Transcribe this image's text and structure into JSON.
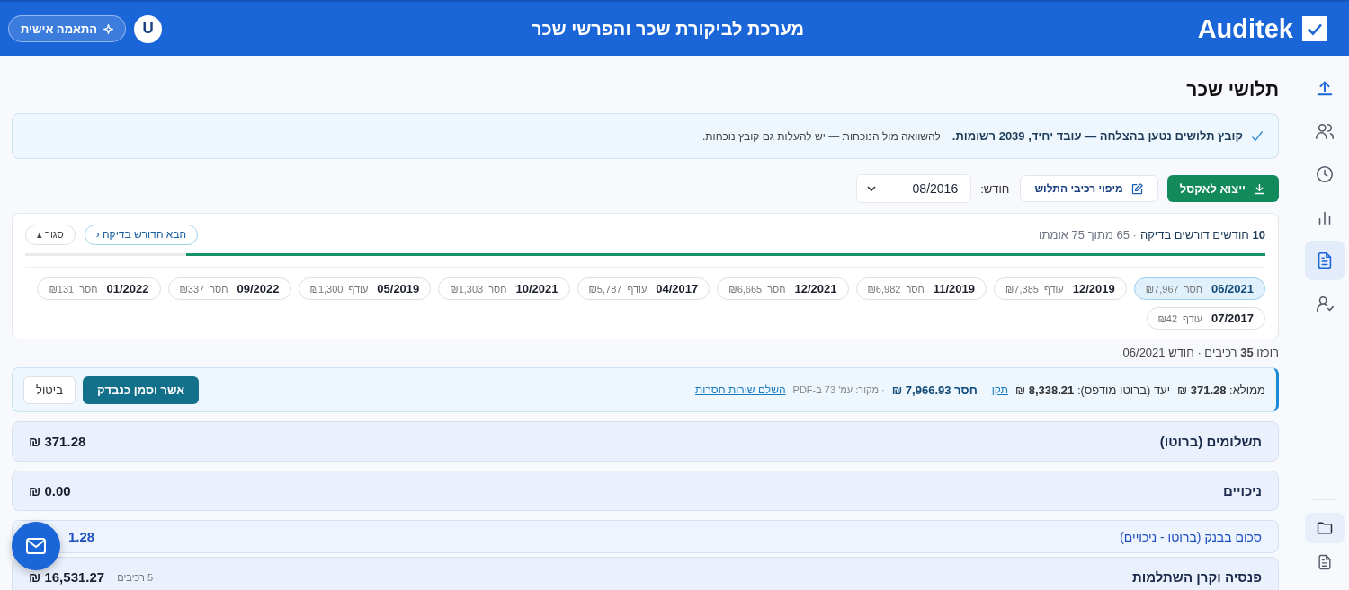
{
  "header": {
    "logo_text": "Auditek",
    "title": "מערכת לביקורת שכר והפרשי שכר",
    "customize_button": "התאמה אישית",
    "avatar": "U"
  },
  "sidebar": {
    "items": [
      {
        "kind": "upload",
        "selected": false,
        "active": true
      },
      {
        "kind": "users",
        "selected": false,
        "active": false
      },
      {
        "kind": "clock",
        "selected": false,
        "active": false
      },
      {
        "kind": "chart",
        "selected": false,
        "active": false
      },
      {
        "kind": "document",
        "selected": true,
        "active": false
      },
      {
        "kind": "user-check",
        "selected": false,
        "active": false
      }
    ],
    "bottom_items": [
      {
        "kind": "folder",
        "selected": true
      },
      {
        "kind": "document",
        "selected": false
      }
    ]
  },
  "page_title": "תלושי שכר",
  "alert": {
    "strong": "קובץ תלושים נטען בהצלחה — עובד יחיד, 2039 רשומות.",
    "note": "להשוואה מול הנוכחות — יש להעלות גם קובץ נוכחות."
  },
  "toolbar": {
    "export_button": "ייצוא לאקסל",
    "mapping_button": "מיפוי רכיבי התלוש",
    "month_label": "חודש:",
    "month_value": "08/2016"
  },
  "review": {
    "count_text": "**10** חודשים דורשים בדיקה",
    "progress_text": "· 65 מתוך 75 אומתו",
    "next_button": "הבא הדורש בדיקה ‹",
    "close_button": "סגור ▴",
    "level": 0.87,
    "months": [
      {
        "month": "06/2021",
        "status": "חסר",
        "amount": "₪7,967",
        "selected": true
      },
      {
        "month": "12/2019",
        "status": "עודף",
        "amount": "₪7,385",
        "selected": false
      },
      {
        "month": "11/2019",
        "status": "חסר",
        "amount": "₪6,982",
        "selected": false
      },
      {
        "month": "12/2021",
        "status": "חסר",
        "amount": "₪6,665",
        "selected": false
      },
      {
        "month": "04/2017",
        "status": "עודף",
        "amount": "₪5,787",
        "selected": false
      },
      {
        "month": "10/2021",
        "status": "חסר",
        "amount": "₪1,303",
        "selected": false
      },
      {
        "month": "05/2019",
        "status": "עודף",
        "amount": "₪1,300",
        "selected": false
      },
      {
        "month": "09/2022",
        "status": "חסר",
        "amount": "₪337",
        "selected": false
      },
      {
        "month": "01/2022",
        "status": "חסר",
        "amount": "₪131",
        "selected": false
      },
      {
        "month": "07/2017",
        "status": "עודף",
        "amount": "₪42",
        "selected": false
      }
    ]
  },
  "collected": "רוכזו **35** רכיבים · חודש 06/2021",
  "edit_bar": {
    "filled": "ממולא: **371.28** ₪",
    "target": "יעד (ברוטו מודפס): **8,338.21** ₪",
    "fix_link": "תקן",
    "missing": "חסר 7,966.93 ₪",
    "source": "· מקור: עמ' 73 ב-PDF",
    "complete_link": "השלם שורות חסרות",
    "confirm_button": "אשר וסמן כנבדק",
    "cancel_button": "ביטול"
  },
  "sections": [
    {
      "kind": "group",
      "label": "תשלומים (ברוטו)",
      "value": "371.28 ₪"
    },
    {
      "kind": "group",
      "label": "ניכויים",
      "value": "0.00 ₪"
    },
    {
      "kind": "total",
      "label": "סכום בבנק (ברוטו - ניכויים)",
      "value": "1.28"
    },
    {
      "kind": "group",
      "label": "פנסיה וקרן השתלמות",
      "value": "16,531.27 ₪",
      "note": "5 רכיבים"
    }
  ]
}
